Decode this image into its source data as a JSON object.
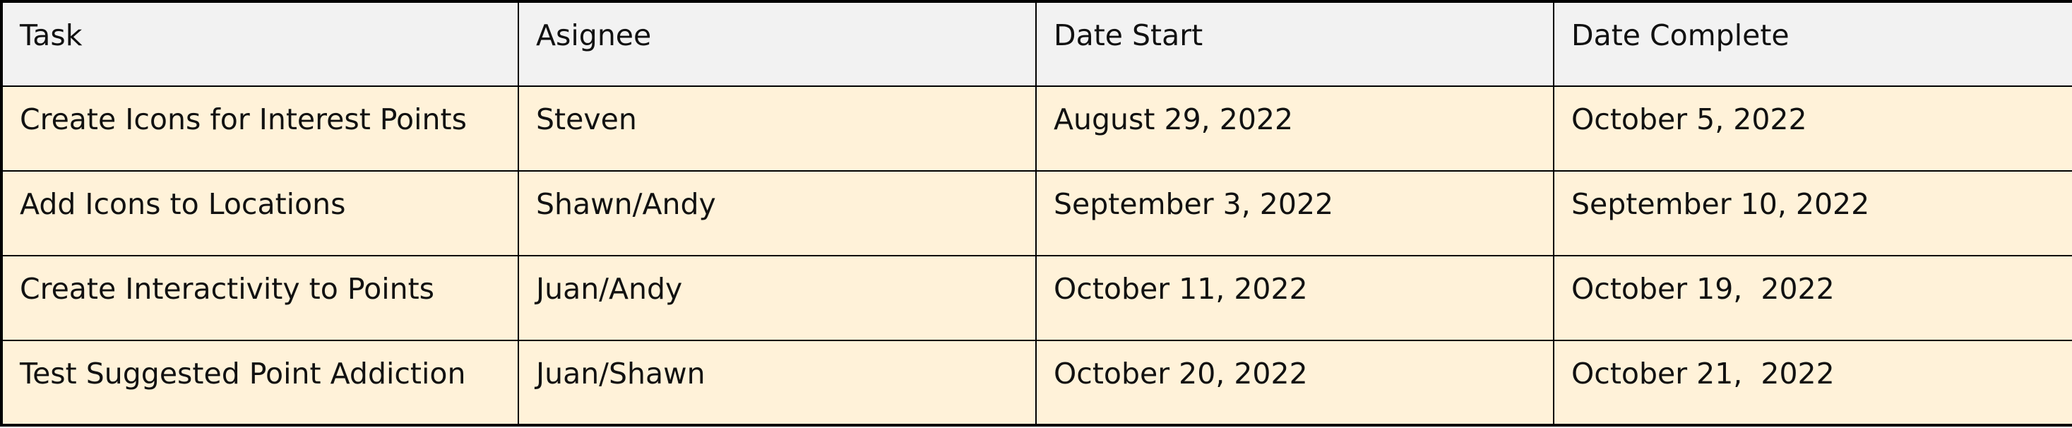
{
  "table": {
    "headers": [
      "Task",
      "Asignee",
      "Date Start",
      "Date Complete"
    ],
    "rows": [
      [
        "Create Icons for Interest Points",
        "Steven",
        "August 29, 2022",
        "October 5, 2022"
      ],
      [
        "Add Icons to Locations",
        "Shawn/Andy",
        "September 3, 2022",
        "September 10, 2022"
      ],
      [
        "Create Interactivity to Points",
        "Juan/Andy",
        "October 11, 2022",
        "October 19,  2022"
      ],
      [
        "Test Suggested Point Addiction",
        "Juan/Shawn",
        "October 20, 2022",
        "October 21,  2022"
      ]
    ],
    "colors": {
      "header_background": "#f2f2f2",
      "row_background": "#fff2d9",
      "border": "#000000",
      "text": "#111111"
    }
  }
}
